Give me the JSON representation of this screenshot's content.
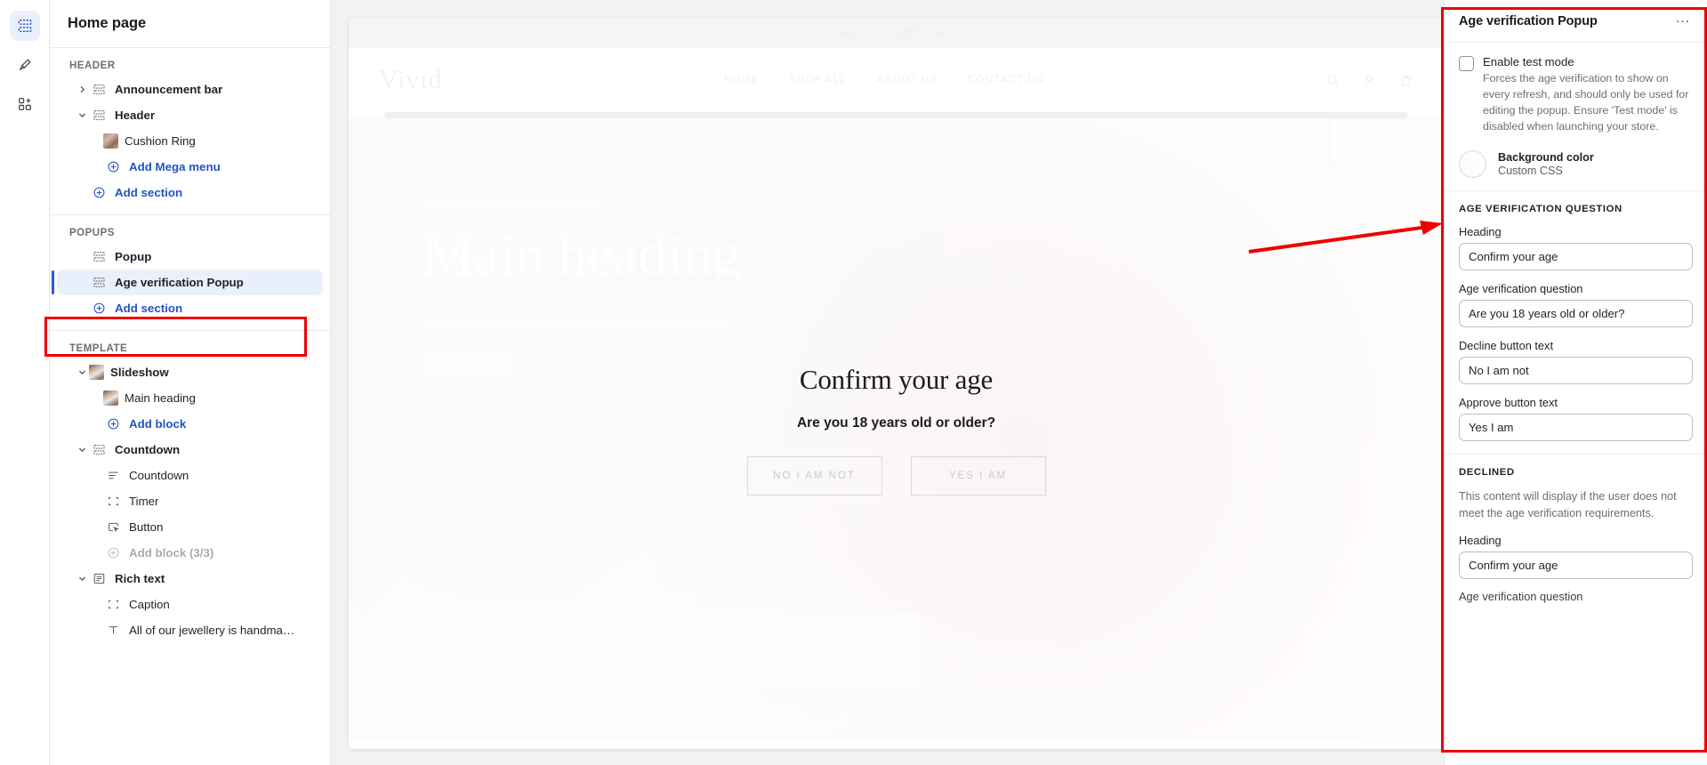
{
  "rail": {
    "items": [
      {
        "name": "sections-icon",
        "active": true
      },
      {
        "name": "paintbrush-icon",
        "active": false
      },
      {
        "name": "apps-icon",
        "active": false
      }
    ]
  },
  "sidebar": {
    "title": "Home page",
    "groups": [
      {
        "label": "HEADER",
        "items": [
          {
            "label": "Announcement bar",
            "icon": "section-icon",
            "caret": "right",
            "bold": true,
            "indent": 0,
            "type": "section"
          },
          {
            "label": "Header",
            "icon": "section-icon",
            "caret": "down",
            "bold": true,
            "indent": 0,
            "type": "section"
          },
          {
            "label": "Cushion Ring",
            "icon": "image-thumb",
            "caret": "none",
            "bold": false,
            "indent": 1,
            "type": "block"
          },
          {
            "label": "Add Mega menu",
            "icon": "plus-circle-icon",
            "caret": "none",
            "bold": false,
            "indent": 1,
            "type": "link"
          },
          {
            "label": "Add section",
            "icon": "plus-circle-icon",
            "caret": "none",
            "bold": false,
            "indent": 0,
            "type": "link"
          }
        ]
      },
      {
        "label": "POPUPS",
        "items": [
          {
            "label": "Popup",
            "icon": "section-icon",
            "caret": "none",
            "bold": true,
            "indent": 0,
            "type": "section"
          },
          {
            "label": "Age verification Popup",
            "icon": "section-icon",
            "caret": "none",
            "bold": true,
            "indent": 0,
            "type": "section",
            "selected": true
          },
          {
            "label": "Add section",
            "icon": "plus-circle-icon",
            "caret": "none",
            "bold": false,
            "indent": 0,
            "type": "link"
          }
        ]
      },
      {
        "label": "TEMPLATE",
        "items": [
          {
            "label": "Slideshow",
            "icon": "image-thumb-slideshow",
            "caret": "down",
            "bold": true,
            "indent": 0,
            "type": "section"
          },
          {
            "label": "Main heading",
            "icon": "image-thumb-slideshow",
            "caret": "none",
            "bold": false,
            "indent": 1,
            "type": "block"
          },
          {
            "label": "Add block",
            "icon": "plus-circle-icon",
            "caret": "none",
            "bold": false,
            "indent": 1,
            "type": "link"
          },
          {
            "label": "Countdown",
            "icon": "section-icon",
            "caret": "down",
            "bold": true,
            "indent": 0,
            "type": "section"
          },
          {
            "label": "Countdown",
            "icon": "text-lines-icon",
            "caret": "none",
            "bold": false,
            "indent": 1,
            "type": "block"
          },
          {
            "label": "Timer",
            "icon": "block-corners-icon",
            "caret": "none",
            "bold": false,
            "indent": 1,
            "type": "block"
          },
          {
            "label": "Button",
            "icon": "button-cursor-icon",
            "caret": "none",
            "bold": false,
            "indent": 1,
            "type": "block"
          },
          {
            "label": "Add block (3/3)",
            "icon": "plus-circle-icon",
            "caret": "none",
            "bold": false,
            "indent": 1,
            "type": "disabled"
          },
          {
            "label": "Rich text",
            "icon": "richtext-icon",
            "caret": "down",
            "bold": true,
            "indent": 0,
            "type": "section"
          },
          {
            "label": "Caption",
            "icon": "block-corners-icon",
            "caret": "none",
            "bold": false,
            "indent": 1,
            "type": "block"
          },
          {
            "label": "All of our jewellery is handma…",
            "icon": "text-icon",
            "caret": "none",
            "bold": false,
            "indent": 1,
            "type": "block"
          }
        ]
      }
    ]
  },
  "preview": {
    "announcement": "ANNOUNCEMENT BAR",
    "logo": "Vivid",
    "nav": [
      "HOME",
      "SHOP ALL",
      "ABOUT US",
      "CONTACT US"
    ],
    "hero_heading": "Main heading",
    "age_popup": {
      "heading": "Confirm your age",
      "question": "Are you 18 years old or older?",
      "decline_button": "NO I AM NOT",
      "approve_button": "YES I AM"
    }
  },
  "settings": {
    "title": "Age verification Popup",
    "more_label": "…",
    "test_mode": {
      "label": "Enable test mode",
      "checked": false,
      "help": "Forces the age verification to show on every refresh, and should only be used for editing the popup. Ensure 'Test mode' is disabled when launching your store."
    },
    "background_color": {
      "label": "Background color",
      "sub": "Custom CSS",
      "value": "#ffffff"
    },
    "question_section": {
      "label": "AGE VERIFICATION QUESTION",
      "fields": [
        {
          "label": "Heading",
          "value": "Confirm your age"
        },
        {
          "label": "Age verification question",
          "value": "Are you 18 years old or older?"
        },
        {
          "label": "Decline button text",
          "value": "No I am not"
        },
        {
          "label": "Approve button text",
          "value": "Yes I am"
        }
      ]
    },
    "declined_section": {
      "label": "DECLINED",
      "description": "This content will display if the user does not meet the age verification requirements.",
      "fields": [
        {
          "label": "Heading",
          "value": "Confirm your age"
        }
      ],
      "next_label": "Age verification question"
    }
  },
  "annotations": {
    "accent_color": "#ee0000",
    "boxes": [
      "sidebar-age-verification-popup",
      "settings-panel"
    ],
    "arrow": "points-to-settings-panel"
  }
}
